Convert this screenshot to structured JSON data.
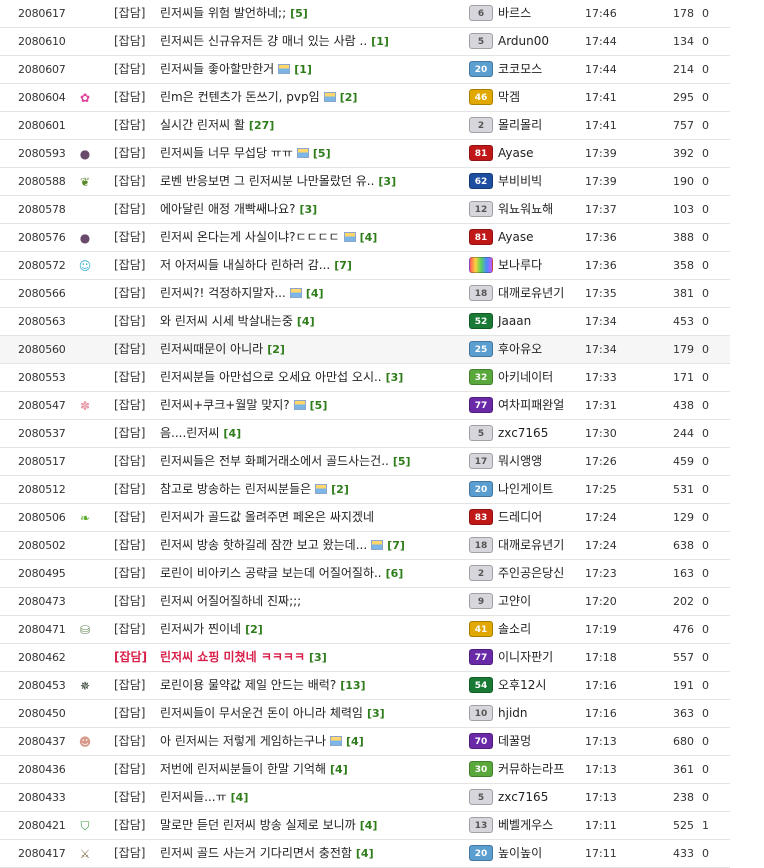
{
  "colors": {
    "hot_title": "#d8204a",
    "comment_count": "#2e7d1a",
    "row_border": "#e4e4e4",
    "row_highlight": "#f6f6f6"
  },
  "posts": [
    {
      "no": "2080617",
      "icon": "",
      "category": "[잡담]",
      "title": "린저씨들 위험 발언하네;;",
      "photo": false,
      "comments": "[5]",
      "level": "6",
      "nick": "바르스",
      "time": "17:46",
      "views": "178",
      "rec": "0"
    },
    {
      "no": "2080610",
      "icon": "",
      "category": "[잡담]",
      "title": "린저씨든 신규유저든 걍 매너 있는 사람 ..",
      "photo": false,
      "comments": "[1]",
      "level": "5",
      "nick": "Ardun00",
      "time": "17:44",
      "views": "134",
      "rec": "0"
    },
    {
      "no": "2080607",
      "icon": "",
      "category": "[잡담]",
      "title": "린저씨들 좋아할만한거",
      "photo": true,
      "comments": "[1]",
      "level": "20",
      "nick": "코코모스",
      "time": "17:44",
      "views": "214",
      "rec": "0"
    },
    {
      "no": "2080604",
      "icon": "rainbow-avatar-icon",
      "category": "[잡담]",
      "title": "린m은 컨텐츠가 돈쓰기, pvp임",
      "photo": true,
      "comments": "[2]",
      "level": "46",
      "nick": "막겜",
      "time": "17:41",
      "views": "295",
      "rec": "0"
    },
    {
      "no": "2080601",
      "icon": "",
      "category": "[잡담]",
      "title": "실시간 린저씨 활",
      "photo": false,
      "comments": "[27]",
      "level": "2",
      "nick": "몰리몰리",
      "time": "17:41",
      "views": "757",
      "rec": "0"
    },
    {
      "no": "2080593",
      "icon": "dark-avatar-icon",
      "category": "[잡담]",
      "title": "린저씨들 너무 무섭당 ㅠㅠ",
      "photo": true,
      "comments": "[5]",
      "level": "81",
      "nick": "Ayase",
      "time": "17:39",
      "views": "392",
      "rec": "0"
    },
    {
      "no": "2080588",
      "icon": "sprout-icon",
      "category": "[잡담]",
      "title": "로벤 반응보면 그 린저씨분 나만몰랐던 유..",
      "photo": false,
      "comments": "[3]",
      "level": "62",
      "nick": "부비비빅",
      "time": "17:39",
      "views": "190",
      "rec": "0"
    },
    {
      "no": "2080578",
      "icon": "",
      "category": "[잡담]",
      "title": "에아달린 애정 개빡쌔나요?",
      "photo": false,
      "comments": "[3]",
      "level": "12",
      "nick": "워뇨워뇨해",
      "time": "17:37",
      "views": "103",
      "rec": "0"
    },
    {
      "no": "2080576",
      "icon": "dark-avatar-icon",
      "category": "[잡담]",
      "title": "린저씨 온다는게 사실이냐?ㄷㄷㄷㄷ",
      "photo": true,
      "comments": "[4]",
      "level": "81",
      "nick": "Ayase",
      "time": "17:36",
      "views": "388",
      "rec": "0"
    },
    {
      "no": "2080572",
      "icon": "cyan-avatar-icon",
      "category": "[잡담]",
      "title": "저 아저씨들 내실하다 린하러 감...",
      "photo": false,
      "comments": "[7]",
      "level": "",
      "nick": "보나루다",
      "time": "17:36",
      "views": "358",
      "rec": "0"
    },
    {
      "no": "2080566",
      "icon": "",
      "category": "[잡담]",
      "title": "린저씨?! 걱정하지말자...",
      "photo": true,
      "comments": "[4]",
      "level": "18",
      "nick": "대깨로유년기",
      "time": "17:35",
      "views": "381",
      "rec": "0"
    },
    {
      "no": "2080563",
      "icon": "",
      "category": "[잡담]",
      "title": "와 린저씨 시세 박살내는중",
      "photo": false,
      "comments": "[4]",
      "level": "52",
      "nick": "Jaaan",
      "time": "17:34",
      "views": "453",
      "rec": "0"
    },
    {
      "no": "2080560",
      "icon": "",
      "category": "[잡담]",
      "title": "린저씨때문이 아니라",
      "photo": false,
      "comments": "[2]",
      "level": "25",
      "nick": "후아유오",
      "time": "17:34",
      "views": "179",
      "rec": "0"
    },
    {
      "no": "2080553",
      "icon": "",
      "category": "[잡담]",
      "title": "린저씨분들 아만섭으로 오세요 아만섭 오시..",
      "photo": false,
      "comments": "[3]",
      "level": "32",
      "nick": "아키네이터",
      "time": "17:33",
      "views": "171",
      "rec": "0"
    },
    {
      "no": "2080547",
      "icon": "pink-flower-icon",
      "category": "[잡담]",
      "title": "린저씨+쿠크+월말 맞지?",
      "photo": true,
      "comments": "[5]",
      "level": "77",
      "nick": "여차피패완얼",
      "time": "17:31",
      "views": "438",
      "rec": "0"
    },
    {
      "no": "2080537",
      "icon": "",
      "category": "[잡담]",
      "title": "음....린저씨",
      "photo": false,
      "comments": "[4]",
      "level": "5",
      "nick": "zxc7165",
      "time": "17:30",
      "views": "244",
      "rec": "0"
    },
    {
      "no": "2080517",
      "icon": "",
      "category": "[잡담]",
      "title": "린저씨들은 전부 화폐거래소에서 골드사는건..",
      "photo": false,
      "comments": "[5]",
      "level": "17",
      "nick": "뭐시앵앵",
      "time": "17:26",
      "views": "459",
      "rec": "0"
    },
    {
      "no": "2080512",
      "icon": "",
      "category": "[잡담]",
      "title": "참고로 방송하는 린저씨분들은",
      "photo": true,
      "comments": "[2]",
      "level": "20",
      "nick": "나인게이트",
      "time": "17:25",
      "views": "531",
      "rec": "0"
    },
    {
      "no": "2080506",
      "icon": "leaf-icon",
      "category": "[잡담]",
      "title": "린저씨가 골드값 올려주면 페온은 싸지겠네",
      "photo": false,
      "comments": "",
      "level": "83",
      "nick": "드레디어",
      "time": "17:24",
      "views": "129",
      "rec": "0"
    },
    {
      "no": "2080502",
      "icon": "",
      "category": "[잡담]",
      "title": "린저씨 방송 핫하길레 잠깐 보고 왔는데...",
      "photo": true,
      "comments": "[7]",
      "level": "18",
      "nick": "대깨로유년기",
      "time": "17:24",
      "views": "638",
      "rec": "0"
    },
    {
      "no": "2080495",
      "icon": "",
      "category": "[잡담]",
      "title": "로린이 비아키스 공략글 보는데 어질어질하..",
      "photo": false,
      "comments": "[6]",
      "level": "2",
      "nick": "주인공은당신",
      "time": "17:23",
      "views": "163",
      "rec": "0"
    },
    {
      "no": "2080473",
      "icon": "",
      "category": "[잡담]",
      "title": "린저씨 어질어질하네 진짜;;;",
      "photo": false,
      "comments": "",
      "level": "9",
      "nick": "고얀이",
      "time": "17:20",
      "views": "202",
      "rec": "0"
    },
    {
      "no": "2080471",
      "icon": "jar-icon",
      "category": "[잡담]",
      "title": "린저씨가 찐이네",
      "photo": false,
      "comments": "[2]",
      "level": "41",
      "nick": "솔소리",
      "time": "17:19",
      "views": "476",
      "rec": "0"
    },
    {
      "no": "2080462",
      "icon": "",
      "category": "[잡담]",
      "title": "린저씨 쇼핑 미쳤네 ㅋㅋㅋㅋ",
      "photo": false,
      "comments": "[3]",
      "level": "77",
      "nick": "이니자판기",
      "time": "17:18",
      "views": "557",
      "rec": "0",
      "hot": true
    },
    {
      "no": "2080453",
      "icon": "cannabis-leaf-icon",
      "category": "[잡담]",
      "title": "로린이용 물약값 제일 안드는 배럭?",
      "photo": false,
      "comments": "[13]",
      "level": "54",
      "nick": "오후12시",
      "time": "17:16",
      "views": "191",
      "rec": "0"
    },
    {
      "no": "2080450",
      "icon": "",
      "category": "[잡담]",
      "title": "린저씨들이 무서운건 돈이 아니라 체력임",
      "photo": false,
      "comments": "[3]",
      "level": "10",
      "nick": "hjidn",
      "time": "17:16",
      "views": "363",
      "rec": "0"
    },
    {
      "no": "2080437",
      "icon": "pig-face-icon",
      "category": "[잡담]",
      "title": "아 린저씨는 저렇게 게임하는구나",
      "photo": true,
      "comments": "[4]",
      "level": "70",
      "nick": "데꿀멍",
      "time": "17:13",
      "views": "680",
      "rec": "0"
    },
    {
      "no": "2080436",
      "icon": "",
      "category": "[잡담]",
      "title": "저번에 린저씨분들이 한말 기억해",
      "photo": false,
      "comments": "[4]",
      "level": "30",
      "nick": "커뮤하는라프",
      "time": "17:13",
      "views": "361",
      "rec": "0"
    },
    {
      "no": "2080433",
      "icon": "",
      "category": "[잡담]",
      "title": "린저씨들...ㅠ",
      "photo": false,
      "comments": "[4]",
      "level": "5",
      "nick": "zxc7165",
      "time": "17:13",
      "views": "238",
      "rec": "0"
    },
    {
      "no": "2080421",
      "icon": "shield-badge-icon",
      "category": "[잡담]",
      "title": "말로만 듣던 린저씨 방송 실제로 보니까",
      "photo": false,
      "comments": "[4]",
      "level": "13",
      "nick": "베벨게우스",
      "time": "17:11",
      "views": "525",
      "rec": "1"
    },
    {
      "no": "2080417",
      "icon": "crossed-swords-icon",
      "category": "[잡담]",
      "title": "린저씨 골드 사는거 기다리면서 충전함",
      "photo": false,
      "comments": "[4]",
      "level": "20",
      "nick": "높이높이",
      "time": "17:11",
      "views": "433",
      "rec": "0"
    }
  ]
}
